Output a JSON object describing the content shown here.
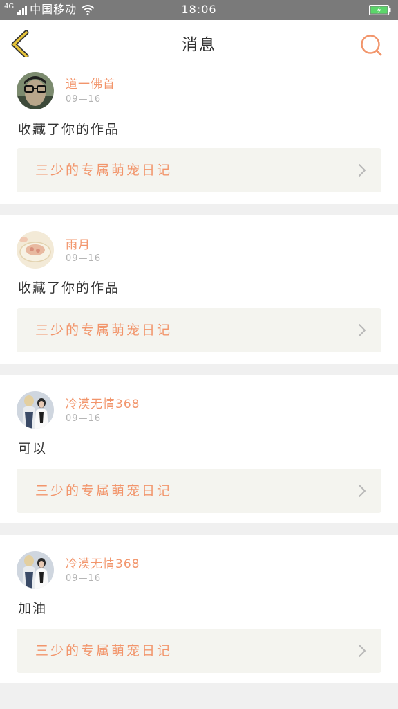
{
  "status_bar": {
    "network": "4G",
    "carrier": "中国移动",
    "time": "18:06",
    "icons": [
      "signal-icon",
      "wifi-icon",
      "battery-charging-icon"
    ]
  },
  "header": {
    "title": "消息",
    "back_icon": "chevron-left-icon",
    "search_icon": "search-icon"
  },
  "colors": {
    "accent": "#f2956b",
    "back_arrow": "#e8c53a",
    "text": "#333333",
    "muted": "#b3b3b3",
    "link_bg": "#f4f4ef"
  },
  "messages": [
    {
      "username": "道一佛首",
      "date": "09—16",
      "text": "收藏了你的作品",
      "work_title": "三少的专属萌宠日记"
    },
    {
      "username": "雨月",
      "date": "09—16",
      "text": "收藏了你的作品",
      "work_title": "三少的专属萌宠日记"
    },
    {
      "username": "冷漠无情368",
      "date": "09—16",
      "text": "可以",
      "work_title": "三少的专属萌宠日记"
    },
    {
      "username": "冷漠无情368",
      "date": "09—16",
      "text": "加油",
      "work_title": "三少的专属萌宠日记"
    }
  ]
}
